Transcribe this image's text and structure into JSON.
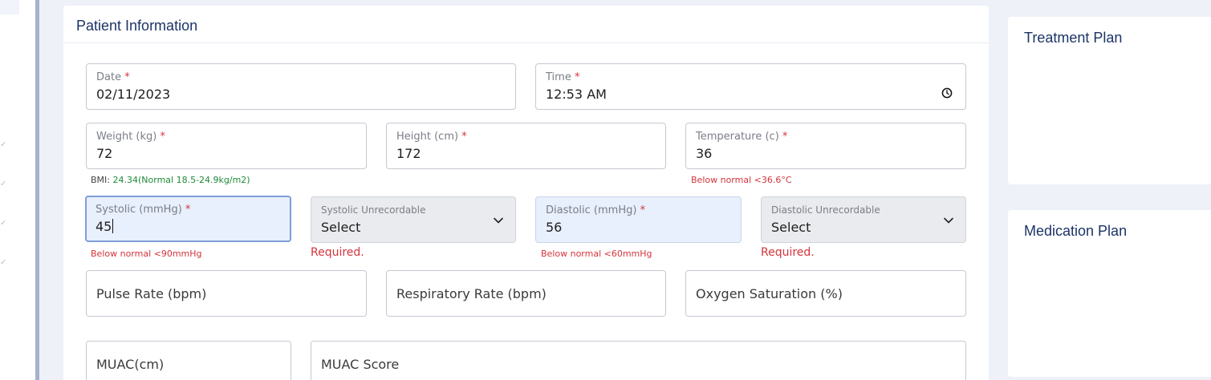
{
  "sidebar": {
    "check_marks": [
      "✓",
      "✓",
      "✓",
      "✓"
    ]
  },
  "patient_info": {
    "title": "Patient Information",
    "date": {
      "label": "Date",
      "required": "*",
      "value": "02/11/2023"
    },
    "time": {
      "label": "Time",
      "required": "*",
      "value": "12:53 AM"
    },
    "weight": {
      "label": "Weight (kg)",
      "required": "*",
      "value": "72"
    },
    "height": {
      "label": "Height (cm)",
      "required": "*",
      "value": "172"
    },
    "temperature": {
      "label": "Temperature (c)",
      "required": "*",
      "value": "36"
    },
    "bmi_hint": {
      "prefix": "BMI:",
      "text": "24.34(Normal 18.5-24.9kg/m2)"
    },
    "temperature_hint": "Below normal <36.6°C",
    "systolic": {
      "label": "Systolic (mmHg)",
      "required": "*",
      "value": "45"
    },
    "systolic_unrecordable": {
      "label": "Systolic Unrecordable",
      "value": "Select"
    },
    "diastolic": {
      "label": "Diastolic (mmHg)",
      "required": "*",
      "value": "56"
    },
    "diastolic_unrecordable": {
      "label": "Diastolic Unrecordable",
      "value": "Select"
    },
    "systolic_hint": "Below normal <90mmHg",
    "systolic_unrecordable_error": "Required.",
    "diastolic_hint": "Below normal <60mmHg",
    "diastolic_unrecordable_error": "Required.",
    "pulse_rate": {
      "placeholder": "Pulse Rate (bpm)"
    },
    "respiratory_rate": {
      "placeholder": "Respiratory Rate (bpm)"
    },
    "oxygen_saturation": {
      "placeholder": "Oxygen Saturation (%)"
    },
    "muac": {
      "placeholder": "MUAC(cm)"
    },
    "muac_score": {
      "placeholder": "MUAC Score"
    }
  },
  "treatment_plan": {
    "title": "Treatment Plan"
  },
  "medication_plan": {
    "title": "Medication Plan"
  },
  "colors": {
    "title": "#1b3466",
    "required": "#d4343c",
    "hint_ok": "#1e8a38",
    "focus_border": "#7f9ed8",
    "focus_bg": "#e8effd"
  }
}
